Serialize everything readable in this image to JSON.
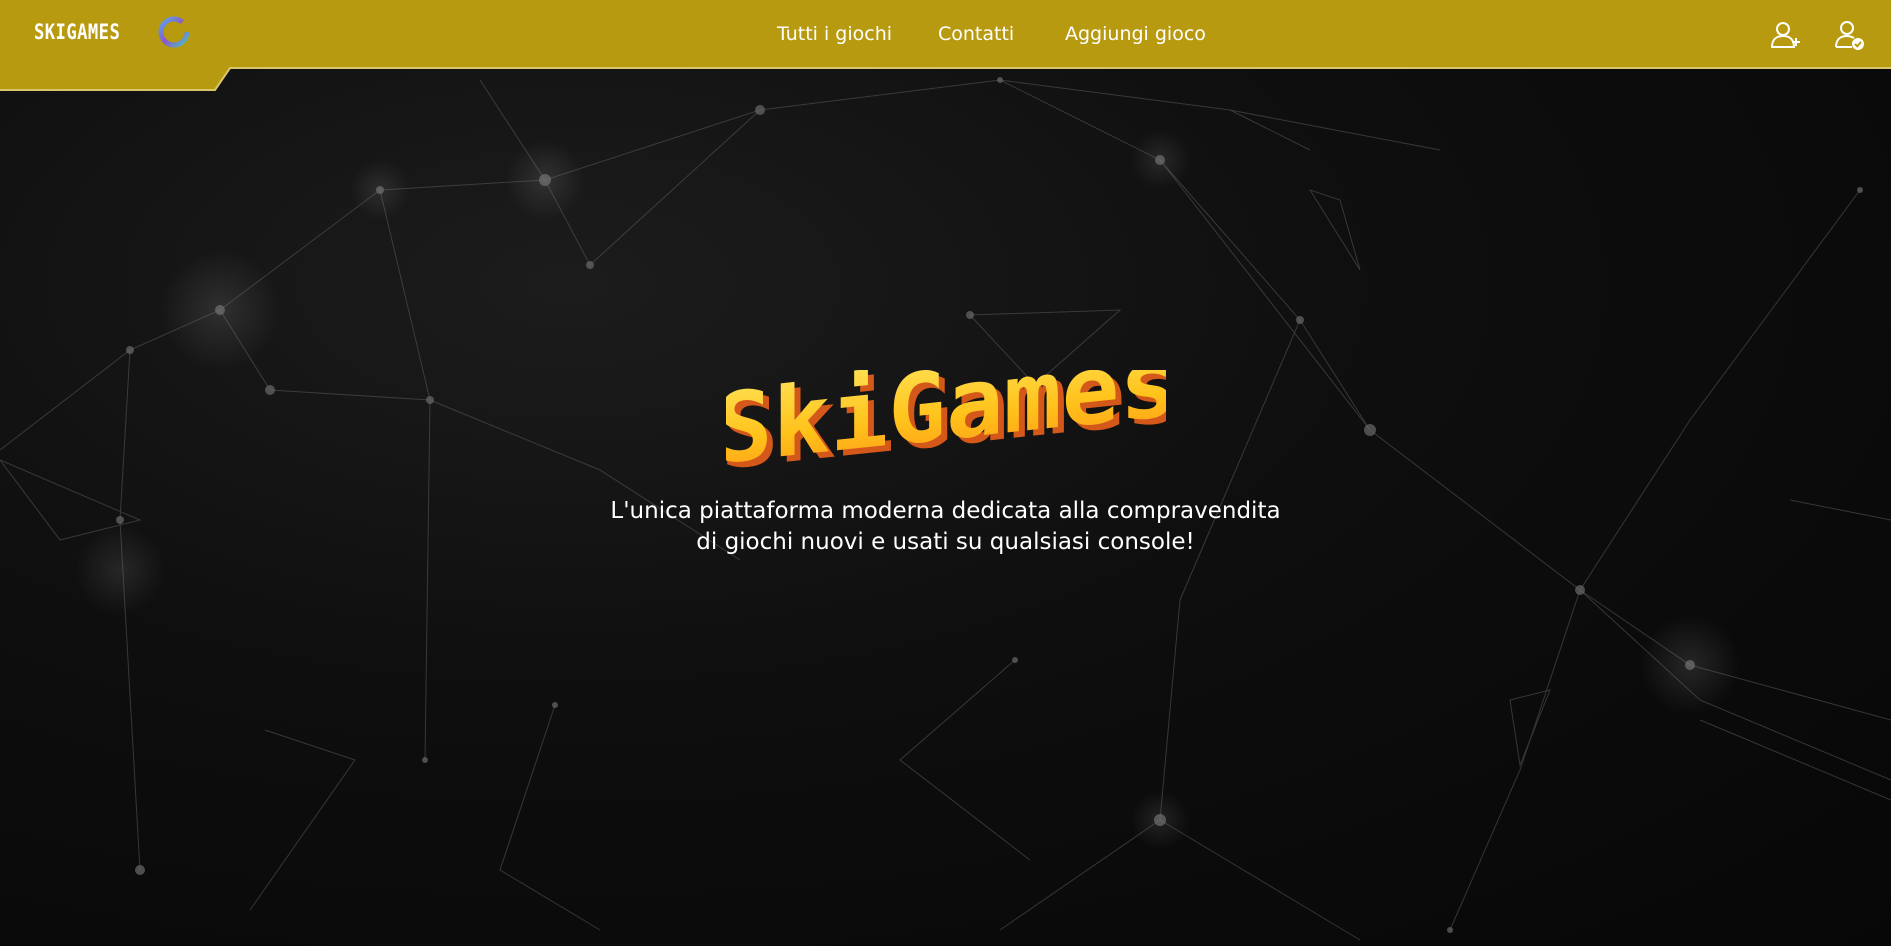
{
  "brand": {
    "name": "SKIGAMES",
    "logo_icon": "ring-logo-icon"
  },
  "nav": {
    "links": [
      {
        "label": "Tutti i giochi"
      },
      {
        "label": "Contatti"
      },
      {
        "label": "Aggiungi gioco"
      }
    ],
    "icons": [
      "user-plus-icon",
      "user-check-icon"
    ]
  },
  "hero": {
    "title": "SkiGames",
    "tagline_line1": "L'unica piattaforma moderna dedicata alla compravendita",
    "tagline_line2": "di giochi nuovi e usati su qualsiasi console!"
  },
  "colors": {
    "header": "#b89a10",
    "background": "#0b0b0b",
    "title_top": "#ffd23a",
    "title_side": "#e0701f",
    "text": "#ffffff"
  }
}
